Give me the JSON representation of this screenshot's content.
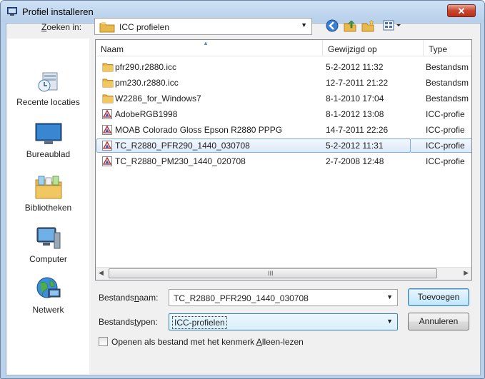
{
  "window": {
    "title": "Profiel installeren",
    "close_label": "✕"
  },
  "lookin": {
    "label_pre": "",
    "label_accel": "Z",
    "label_post": "oeken in:",
    "value": "ICC profielen"
  },
  "places": [
    {
      "label": "Recente locaties",
      "icon": "recent-places-icon"
    },
    {
      "label": "Bureaublad",
      "icon": "desktop-icon"
    },
    {
      "label": "Bibliotheken",
      "icon": "libraries-icon"
    },
    {
      "label": "Computer",
      "icon": "computer-icon"
    },
    {
      "label": "Netwerk",
      "icon": "network-icon"
    }
  ],
  "columns": {
    "name": "Naam",
    "modified": "Gewijzigd op",
    "type": "Type"
  },
  "files": [
    {
      "name": "pfr290.r2880.icc",
      "date": "5-2-2012 11:32",
      "type": "Bestandsm",
      "kind": "folder"
    },
    {
      "name": "pm230.r2880.icc",
      "date": "12-7-2011 21:22",
      "type": "Bestandsm",
      "kind": "folder"
    },
    {
      "name": "W2286_for_Windows7",
      "date": "8-1-2010 17:04",
      "type": "Bestandsm",
      "kind": "folder"
    },
    {
      "name": "AdobeRGB1998",
      "date": "8-1-2012 13:08",
      "type": "ICC-profie",
      "kind": "icc"
    },
    {
      "name": "MOAB Colorado Gloss Epson R2880 PPPG",
      "date": "14-7-2011 22:26",
      "type": "ICC-profie",
      "kind": "icc"
    },
    {
      "name": "TC_R2880_PFR290_1440_030708",
      "date": "5-2-2012 11:31",
      "type": "ICC-profie",
      "kind": "icc",
      "selected": true
    },
    {
      "name": "TC_R2880_PM230_1440_020708",
      "date": "2-7-2008 12:48",
      "type": "ICC-profie",
      "kind": "icc"
    }
  ],
  "scrollbar": {
    "grip": "III"
  },
  "filename": {
    "label_pre": "Bestands",
    "label_accel": "n",
    "label_post": "aam:",
    "value": "TC_R2880_PFR290_1440_030708"
  },
  "filetype": {
    "label_pre": "Bestands",
    "label_accel": "t",
    "label_post": "ypen:",
    "value": "ICC-profielen"
  },
  "buttons": {
    "add": "Toevoegen",
    "cancel": "Annuleren"
  },
  "readonly": {
    "label_pre": "Openen als bestand met het kenmerk ",
    "label_accel": "A",
    "label_post": "lleen-lezen"
  },
  "colors": {
    "selection": "#dceaf9",
    "folder": "#e8b84a",
    "accent": "#3c7fb1"
  }
}
